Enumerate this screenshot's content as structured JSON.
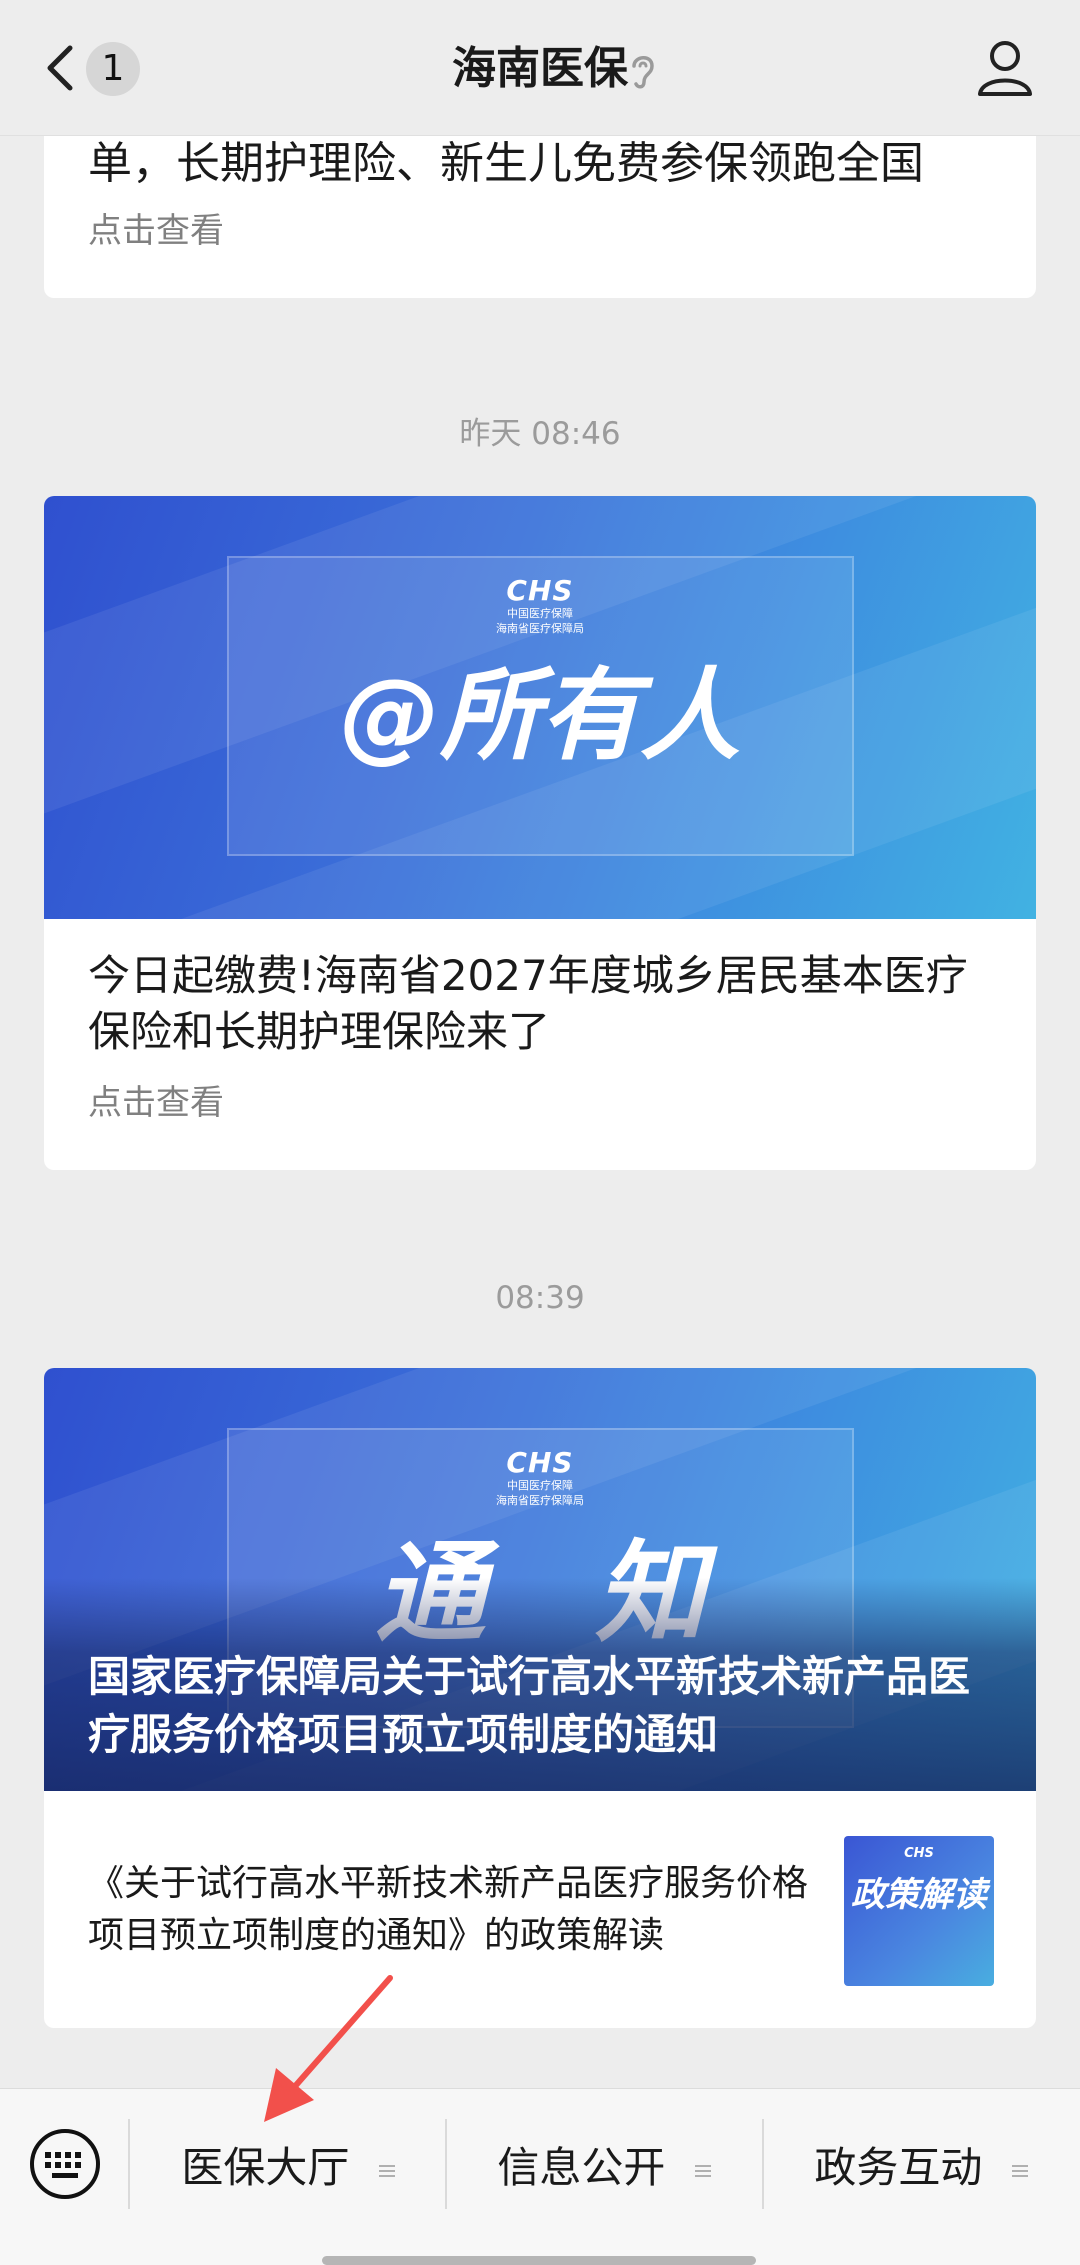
{
  "header": {
    "badge": "1",
    "title": "海南医保"
  },
  "messages": [
    {
      "headline": "单，长期护理险、新生儿免费参保领跑全国",
      "link": "点击查看"
    },
    {
      "time": "昨天 08:46",
      "logo": "CHS",
      "logo_sub1": "中国医疗保障",
      "logo_sub2": "海南省医疗保障局",
      "banner_text": "@所有人",
      "headline": "今日起缴费!海南省2027年度城乡居民基本医疗保险和长期护理保险来了",
      "link": "点击查看"
    },
    {
      "time": "08:39",
      "logo": "CHS",
      "logo_sub1": "中国医疗保障",
      "logo_sub2": "海南省医疗保障局",
      "banner_text": "通　知",
      "overlay_title": "国家医疗保障局关于试行高水平新技术新产品医疗服务价格项目预立项制度的通知",
      "sub_title": "《关于试行高水平新技术新产品医疗服务价格项目预立项制度的通知》的政策解读",
      "thumb_logo": "CHS",
      "thumb_text": "政策解读"
    }
  ],
  "bottom_menu": [
    {
      "label": "医保大厅"
    },
    {
      "label": "信息公开"
    },
    {
      "label": "政务互动"
    }
  ],
  "colors": {
    "annotation_arrow": "#f2504b",
    "banner_blue": "#3b6fd9"
  }
}
